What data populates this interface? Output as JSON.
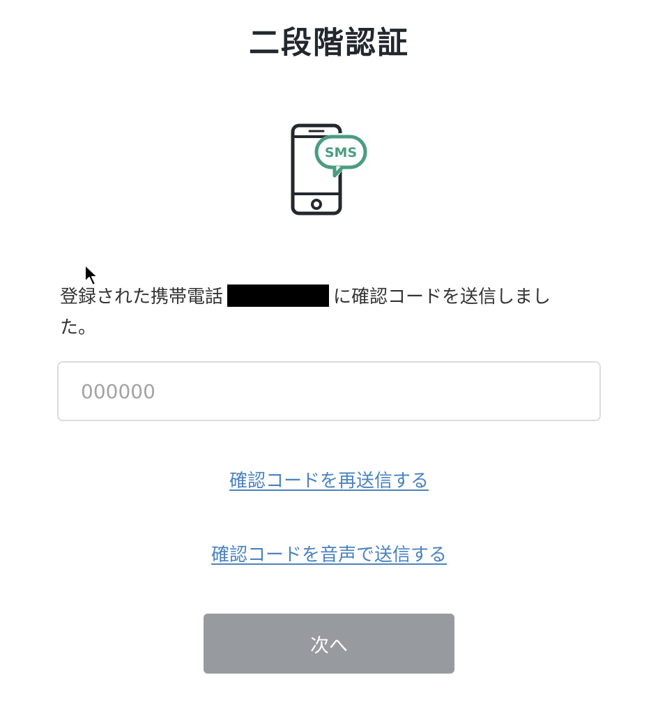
{
  "page": {
    "title": "二段階認証"
  },
  "illustration": {
    "icon": "phone-sms-icon",
    "badge_text": "SMS",
    "accent_color": "#4a9d7f",
    "outline_color": "#23272e"
  },
  "message": {
    "before_phone": "登録された携帯電話",
    "after_phone": "に確認コードを送信しました。"
  },
  "code_input": {
    "value": "",
    "placeholder": "000000"
  },
  "links": {
    "resend": "確認コードを再送信する",
    "voice": "確認コードを音声で送信する",
    "color": "#4a82be"
  },
  "next_button": {
    "label": "次へ",
    "color": "#979a9e"
  }
}
